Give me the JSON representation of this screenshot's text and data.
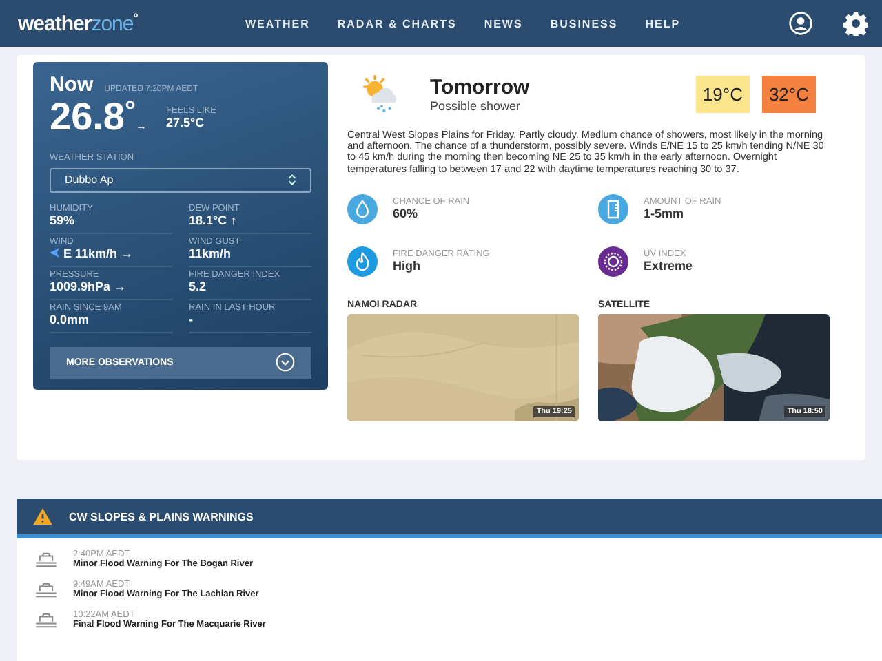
{
  "header": {
    "logo_main": "weather",
    "logo_accent": "zone",
    "logo_mark": "°",
    "nav": [
      {
        "label": "WEATHER",
        "selected": false
      },
      {
        "label": "RADAR & CHARTS",
        "selected": false
      },
      {
        "label": "NEWS",
        "selected": false
      },
      {
        "label": "BUSINESS",
        "selected": false
      },
      {
        "label": "HELP",
        "selected": false
      }
    ]
  },
  "now": {
    "title": "Now",
    "updated": "UPDATED 7:20PM AEDT",
    "temperature": "26.8",
    "degree": "°",
    "trend": "→",
    "feels_like_label": "FEELS LIKE",
    "feels_like": "27.5°C",
    "station_label": "WEATHER STATION",
    "station": "Dubbo Ap",
    "observations": [
      {
        "kind": "plain",
        "label": "HUMIDITY",
        "value": "59%"
      },
      {
        "kind": "plain",
        "label": "DEW POINT",
        "value": "18.1°C ↑"
      },
      {
        "kind": "wind",
        "label": "WIND",
        "value": "E 11km/h →"
      },
      {
        "kind": "plain",
        "label": "WIND GUST",
        "value": "11km/h"
      },
      {
        "kind": "plain",
        "label": "PRESSURE",
        "value": "1009.9hPa →"
      },
      {
        "kind": "plain",
        "label": "FIRE DANGER INDEX",
        "value": "5.2"
      },
      {
        "kind": "plain",
        "label": "RAIN SINCE 9AM",
        "value": "0.0mm"
      },
      {
        "kind": "plain",
        "label": "RAIN IN LAST HOUR",
        "value": "-"
      }
    ],
    "more_button": "MORE OBSERVATIONS"
  },
  "forecast": {
    "day": "Tomorrow",
    "summary": "Possible shower",
    "min": "19°C",
    "max": "32°C",
    "description": "Central West Slopes Plains for Friday. Partly cloudy. Medium chance of showers, most likely in the morning and afternoon. The chance of a thunderstorm, possibly severe. Winds E/NE 15 to 25 km/h tending N/NE 30 to 45 km/h during the morning then becoming NE 25 to 35 km/h in the early afternoon. Overnight temperatures falling to between 17 and 22 with daytime temperatures reaching 30 to 37.",
    "stats": [
      {
        "kind": "drop",
        "label": "CHANCE OF RAIN",
        "value": "60%",
        "color": "#4aa8e0"
      },
      {
        "kind": "gauge",
        "label": "AMOUNT OF RAIN",
        "value": "1-5mm",
        "color": "#4aa8e0"
      },
      {
        "kind": "flame",
        "label": "FIRE DANGER RATING",
        "value": "High",
        "color": "#1e9be0"
      },
      {
        "kind": "sun",
        "label": "UV INDEX",
        "value": "Extreme",
        "color": "#6a2d91"
      }
    ]
  },
  "maps": [
    {
      "title": "NAMOI RADAR",
      "timestamp": "Thu 19:25",
      "kind": "radar"
    },
    {
      "title": "SATELLITE",
      "timestamp": "Thu 18:50",
      "kind": "satellite"
    }
  ],
  "warnings": {
    "title": "CW SLOPES & PLAINS WARNINGS",
    "items": [
      {
        "time": "2:40PM AEDT",
        "text": "Minor Flood Warning For The Bogan River"
      },
      {
        "time": "9:49AM AEDT",
        "text": "Minor Flood Warning For The Lachlan River"
      },
      {
        "time": "10:22AM AEDT",
        "text": "Final Flood Warning For The Macquarie River"
      }
    ]
  }
}
